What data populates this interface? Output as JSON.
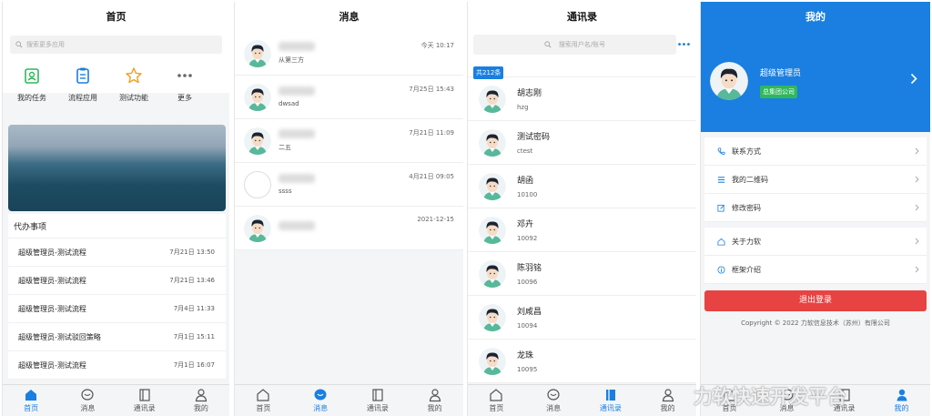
{
  "home": {
    "title": "首页",
    "search_placeholder": "搜索更多应用",
    "quick": [
      "我的任务",
      "流程应用",
      "测试功能",
      "更多"
    ],
    "todo_title": "代办事项",
    "todos": [
      {
        "title": "超级管理员-测试流程",
        "date": "7月21日 13:50"
      },
      {
        "title": "超级管理员-测试流程",
        "date": "7月21日 13:46"
      },
      {
        "title": "超级管理员-测试流程",
        "date": "7月4日 11:33"
      },
      {
        "title": "超级管理员-测试驳回策略",
        "date": "7月1日 15:11"
      },
      {
        "title": "超级管理员-测试流程",
        "date": "7月1日 16:07"
      }
    ]
  },
  "messages": {
    "title": "消息",
    "items": [
      {
        "sub": "从第三方",
        "time": "今天 10:17"
      },
      {
        "sub": "dwsad",
        "time": "7月25日 15:43"
      },
      {
        "sub": "二五",
        "time": "7月21日 11:09"
      },
      {
        "sub": "ssss",
        "time": "4月21日 09:05"
      },
      {
        "sub": "",
        "time": "2021-12-15"
      }
    ]
  },
  "contacts": {
    "title": "通讯录",
    "search_placeholder": "搜索用户名/账号",
    "more": "•••",
    "count": "共212条",
    "items": [
      {
        "name": "胡志刚",
        "id": "hzg"
      },
      {
        "name": "测试密码",
        "id": "ctest"
      },
      {
        "name": "胡函",
        "id": "10100"
      },
      {
        "name": "邓卉",
        "id": "10092"
      },
      {
        "name": "陈羽铭",
        "id": "10096"
      },
      {
        "name": "刘咸昌",
        "id": "10094"
      },
      {
        "name": "龙珠",
        "id": "10095"
      }
    ]
  },
  "mine": {
    "title": "我的",
    "user_name": "超级管理员",
    "org": "总集团公司",
    "menu1": [
      "联系方式",
      "我的二维码",
      "修改密码"
    ],
    "menu2": [
      "关于力软",
      "框架介绍"
    ],
    "logout": "退出登录",
    "copyright": "Copyright © 2022 力软信息技术（苏州）有限公司"
  },
  "tabs": [
    "首页",
    "消息",
    "通讯录",
    "我的"
  ],
  "watermark": "力软快速开发平台",
  "colors": {
    "accent": "#1a7fe0",
    "logout": "#e74343",
    "org_badge": "#2fb85b"
  }
}
